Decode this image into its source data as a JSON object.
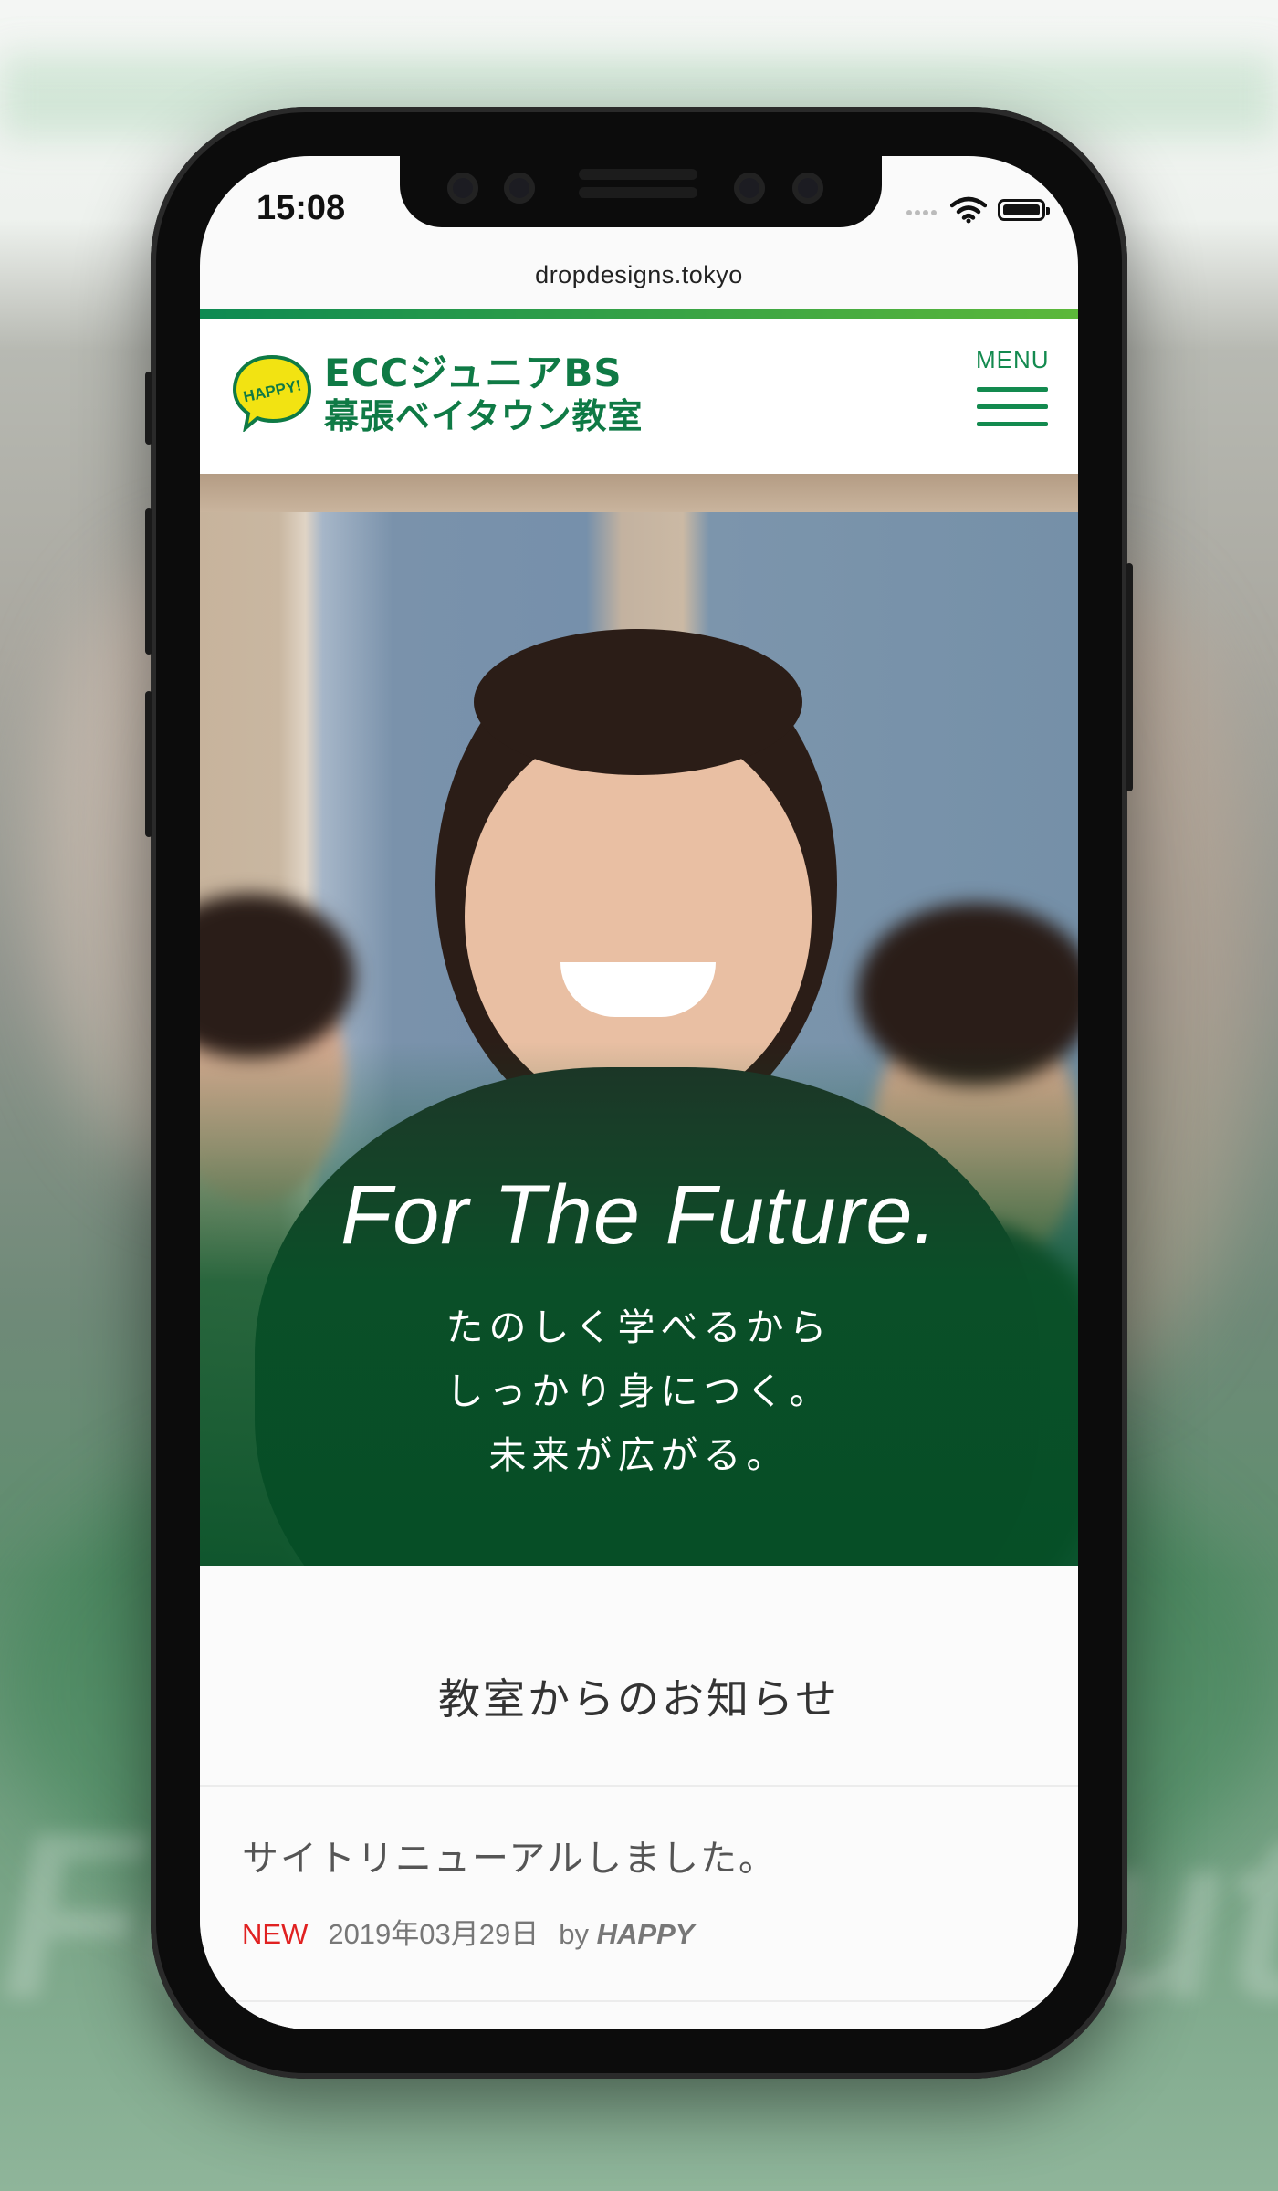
{
  "status_bar": {
    "time": "15:08",
    "icons": [
      "signal-dots-icon",
      "wifi-icon",
      "battery-icon"
    ]
  },
  "browser": {
    "url": "dropdesigns.tokyo"
  },
  "header": {
    "logo_badge": "HAPPY!",
    "logo_line1": "ECCジュニアBS",
    "logo_line2": "幕張ベイタウン教室",
    "menu_label": "MENU"
  },
  "hero": {
    "title": "For The Future.",
    "copy_line1": "たのしく学べるから",
    "copy_line2": "しっかり身につく。",
    "copy_line3": "未来が広がる。"
  },
  "news": {
    "heading": "教室からのお知らせ",
    "items": [
      {
        "title": "サイトリニューアルしました。",
        "badge": "NEW",
        "date": "2019年03月29日",
        "by": "by",
        "author": "HAPPY"
      }
    ]
  },
  "colors": {
    "brand_green": "#0f7a45",
    "accent_green": "#5cb83a",
    "new_red": "#e02121",
    "logo_yellow": "#f2e312"
  }
}
